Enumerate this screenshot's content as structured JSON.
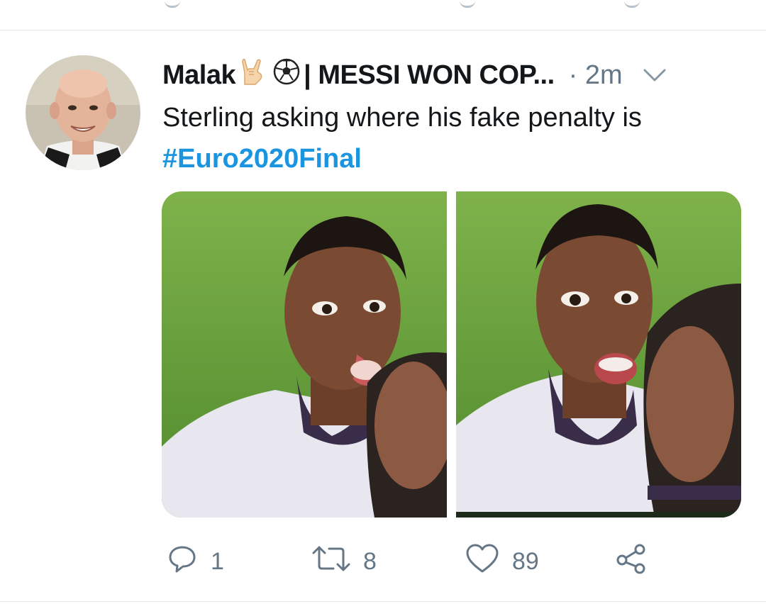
{
  "tweet": {
    "display_name": "Malak",
    "name_rest": "| MESSI WON COP...",
    "emojis": [
      "sign-of-horns-emoji",
      "soccer-ball-emoji"
    ],
    "separator": "·",
    "time": "2m",
    "text": "Sterling asking where his fake penalty is",
    "hashtag": "#Euro2020Final"
  },
  "actions": {
    "replies": "1",
    "retweets": "8",
    "likes": "89"
  },
  "icons": {
    "reply": "reply-icon",
    "retweet": "retweet-icon",
    "like": "heart-icon",
    "share": "share-icon",
    "menu": "chevron-down-icon"
  },
  "colors": {
    "text": "#14171a",
    "secondary": "#657786",
    "hashtag": "#1b95e0",
    "divider": "#e3e7eb"
  }
}
